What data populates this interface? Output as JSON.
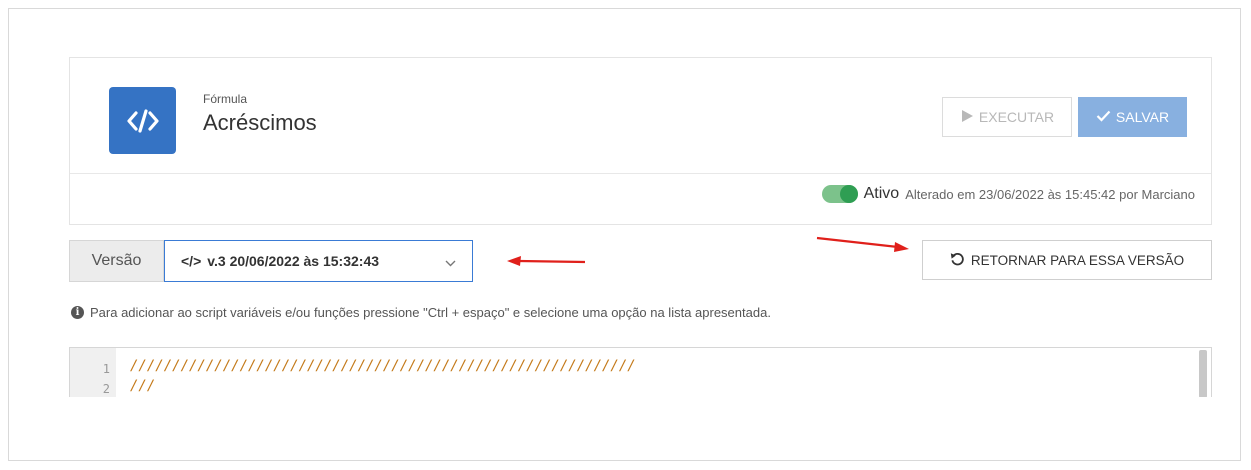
{
  "header": {
    "caption": "Fórmula",
    "title": "Acréscimos",
    "execute_label": "EXECUTAR",
    "save_label": "SALVAR"
  },
  "status": {
    "toggle_on": true,
    "label": "Ativo",
    "changed_text": "Alterado em 23/06/2022 às 15:45:42 por Marciano"
  },
  "version": {
    "label": "Versão",
    "selected": "v.3 20/06/2022 às 15:32:43"
  },
  "return_button": {
    "label": "RETORNAR PARA ESSA VERSÃO"
  },
  "hint": "Para adicionar ao script variáveis e/ou funções pressione \"Ctrl + espaço\" e selecione uma opção na lista apresentada.",
  "editor": {
    "lines": [
      {
        "number": "1",
        "text": "////////////////////////////////////////////////////////////"
      },
      {
        "number": "2",
        "text": "///"
      }
    ]
  },
  "colors": {
    "brand": "#3573c4",
    "save_button": "#88b0e0",
    "toggle": "#2f9e53",
    "annotation_arrow": "#e0201b",
    "code_comment": "#c47a1a"
  }
}
